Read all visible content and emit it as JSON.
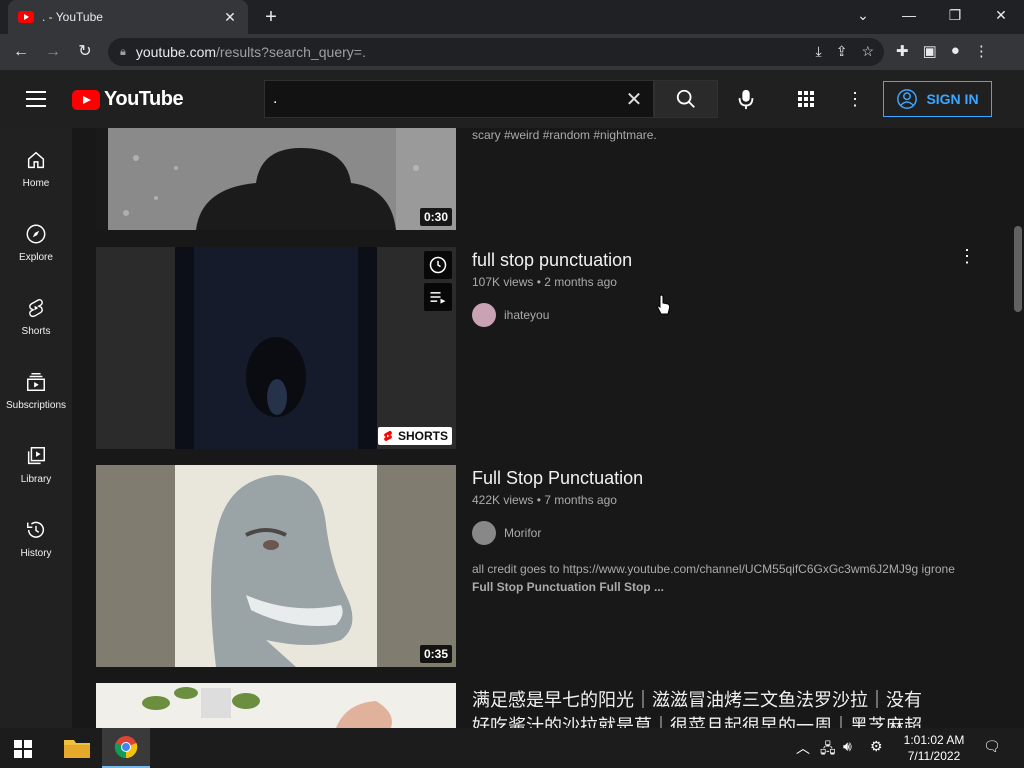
{
  "browser": {
    "tab_title": ". - YouTube",
    "url_host": "youtube.com",
    "url_path": "/results?search_query=."
  },
  "youtube": {
    "logo_text": "YouTube",
    "search_value": ".",
    "signin_label": "SIGN IN"
  },
  "sidebar": {
    "items": [
      {
        "label": "Home",
        "icon": "home-icon"
      },
      {
        "label": "Explore",
        "icon": "compass-icon"
      },
      {
        "label": "Shorts",
        "icon": "shorts-icon"
      },
      {
        "label": "Subscriptions",
        "icon": "subscriptions-icon"
      },
      {
        "label": "Library",
        "icon": "library-icon"
      },
      {
        "label": "History",
        "icon": "history-icon"
      }
    ]
  },
  "results": [
    {
      "description": "scary #weird #random #nightmare.",
      "duration": "0:30"
    },
    {
      "title": "full stop punctuation",
      "meta": "107K views • 2 months ago",
      "channel": "ihateyou",
      "badge": "SHORTS"
    },
    {
      "title": "Full Stop Punctuation",
      "meta": "422K views • 7 months ago",
      "channel": "Morifor",
      "description_line1": "all credit goes to https://www.youtube.com/channel/UCM55qifC6GxGc3wm6J2MJ9g igrone",
      "description_line2": "Full Stop Punctuation Full Stop ...",
      "duration": "0:35"
    },
    {
      "title_line1": "满足感是早七的阳光｜滋滋冒油烤三文鱼法罗沙拉｜没有",
      "title_line2": "好吃酱汁的沙拉就是草｜很菜且起很早的一周｜黑芝麻超..."
    }
  ],
  "taskbar": {
    "time": "1:01:02 AM",
    "date": "7/11/2022"
  },
  "colors": {
    "accent": "#3ea6ff",
    "brand_red": "#ff0000"
  }
}
